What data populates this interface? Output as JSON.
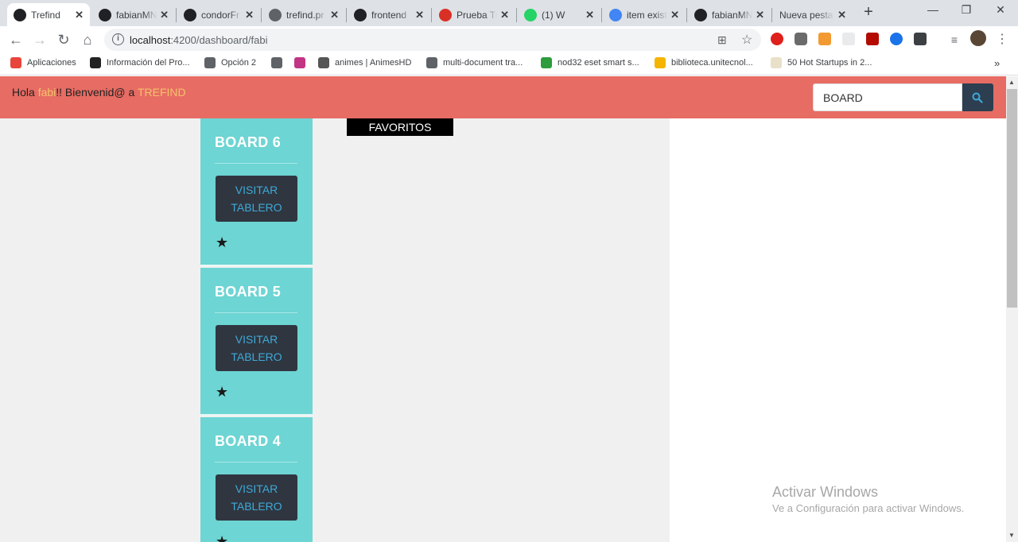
{
  "browser": {
    "tabs": [
      {
        "title": "Trefind",
        "icon": "angular-icon",
        "color": "#202124",
        "active": true
      },
      {
        "title": "fabianMN",
        "icon": "github-icon",
        "color": "#202124"
      },
      {
        "title": "condorFr",
        "icon": "github-icon",
        "color": "#202124"
      },
      {
        "title": "trefind.pr",
        "icon": "globe-icon",
        "color": "#5f6368"
      },
      {
        "title": "frontend",
        "icon": "github-icon",
        "color": "#202124"
      },
      {
        "title": "Prueba Tr",
        "icon": "gmail-icon",
        "color": "#d93025"
      },
      {
        "title": "(1) W",
        "icon": "whatsapp-icon",
        "color": "#25d366"
      },
      {
        "title": "item exist",
        "icon": "google-icon",
        "color": "#4285f4"
      },
      {
        "title": "fabianMN",
        "icon": "github-icon",
        "color": "#202124"
      },
      {
        "title": "Nueva pestañ",
        "icon": "",
        "color": "#dee1e6"
      }
    ],
    "url_host": "localhost",
    "url_path": ":4200/dashboard/fabi",
    "bookmarks": [
      {
        "label": "Aplicaciones",
        "icon": "apps-grid-icon",
        "color": "#e8453c"
      },
      {
        "label": "Información del Pro...",
        "icon": "blackboard-icon",
        "color": "#222222"
      },
      {
        "label": "Opción 2",
        "icon": "globe-icon",
        "color": "#5f6368"
      },
      {
        "label": "",
        "icon": "globe-icon",
        "color": "#5f6368"
      },
      {
        "label": "",
        "icon": "instagram-icon",
        "color": "#c13584"
      },
      {
        "label": "animes | AnimesHD",
        "icon": "anime-icon",
        "color": "#555555"
      },
      {
        "label": "multi-document tra...",
        "icon": "globe-icon",
        "color": "#5f6368"
      },
      {
        "label": "nod32 eset smart s...",
        "icon": "eset-icon",
        "color": "#2d9c3c"
      },
      {
        "label": "biblioteca.unitecnol...",
        "icon": "rainbow-icon",
        "color": "#f4b400"
      },
      {
        "label": "50 Hot Startups in 2...",
        "icon": "et-icon",
        "color": "#e8e0c8"
      }
    ]
  },
  "navbar": {
    "greeting_prefix": "Hola ",
    "username": "fabi",
    "greeting_mid": "!! Bienvenid@ a ",
    "brand": "TREFIND",
    "search_value": "BOARD",
    "color": "#e76c63"
  },
  "favorites_label": "FAVORITOS",
  "boards": [
    {
      "title": "BOARD 6",
      "button": "VISITAR TABLERO"
    },
    {
      "title": "BOARD 5",
      "button": "VISITAR TABLERO"
    },
    {
      "title": "BOARD 4",
      "button": "VISITAR TABLERO"
    }
  ],
  "watermark": {
    "title": "Activar Windows",
    "subtitle": "Ve a Configuración para activar Windows."
  }
}
